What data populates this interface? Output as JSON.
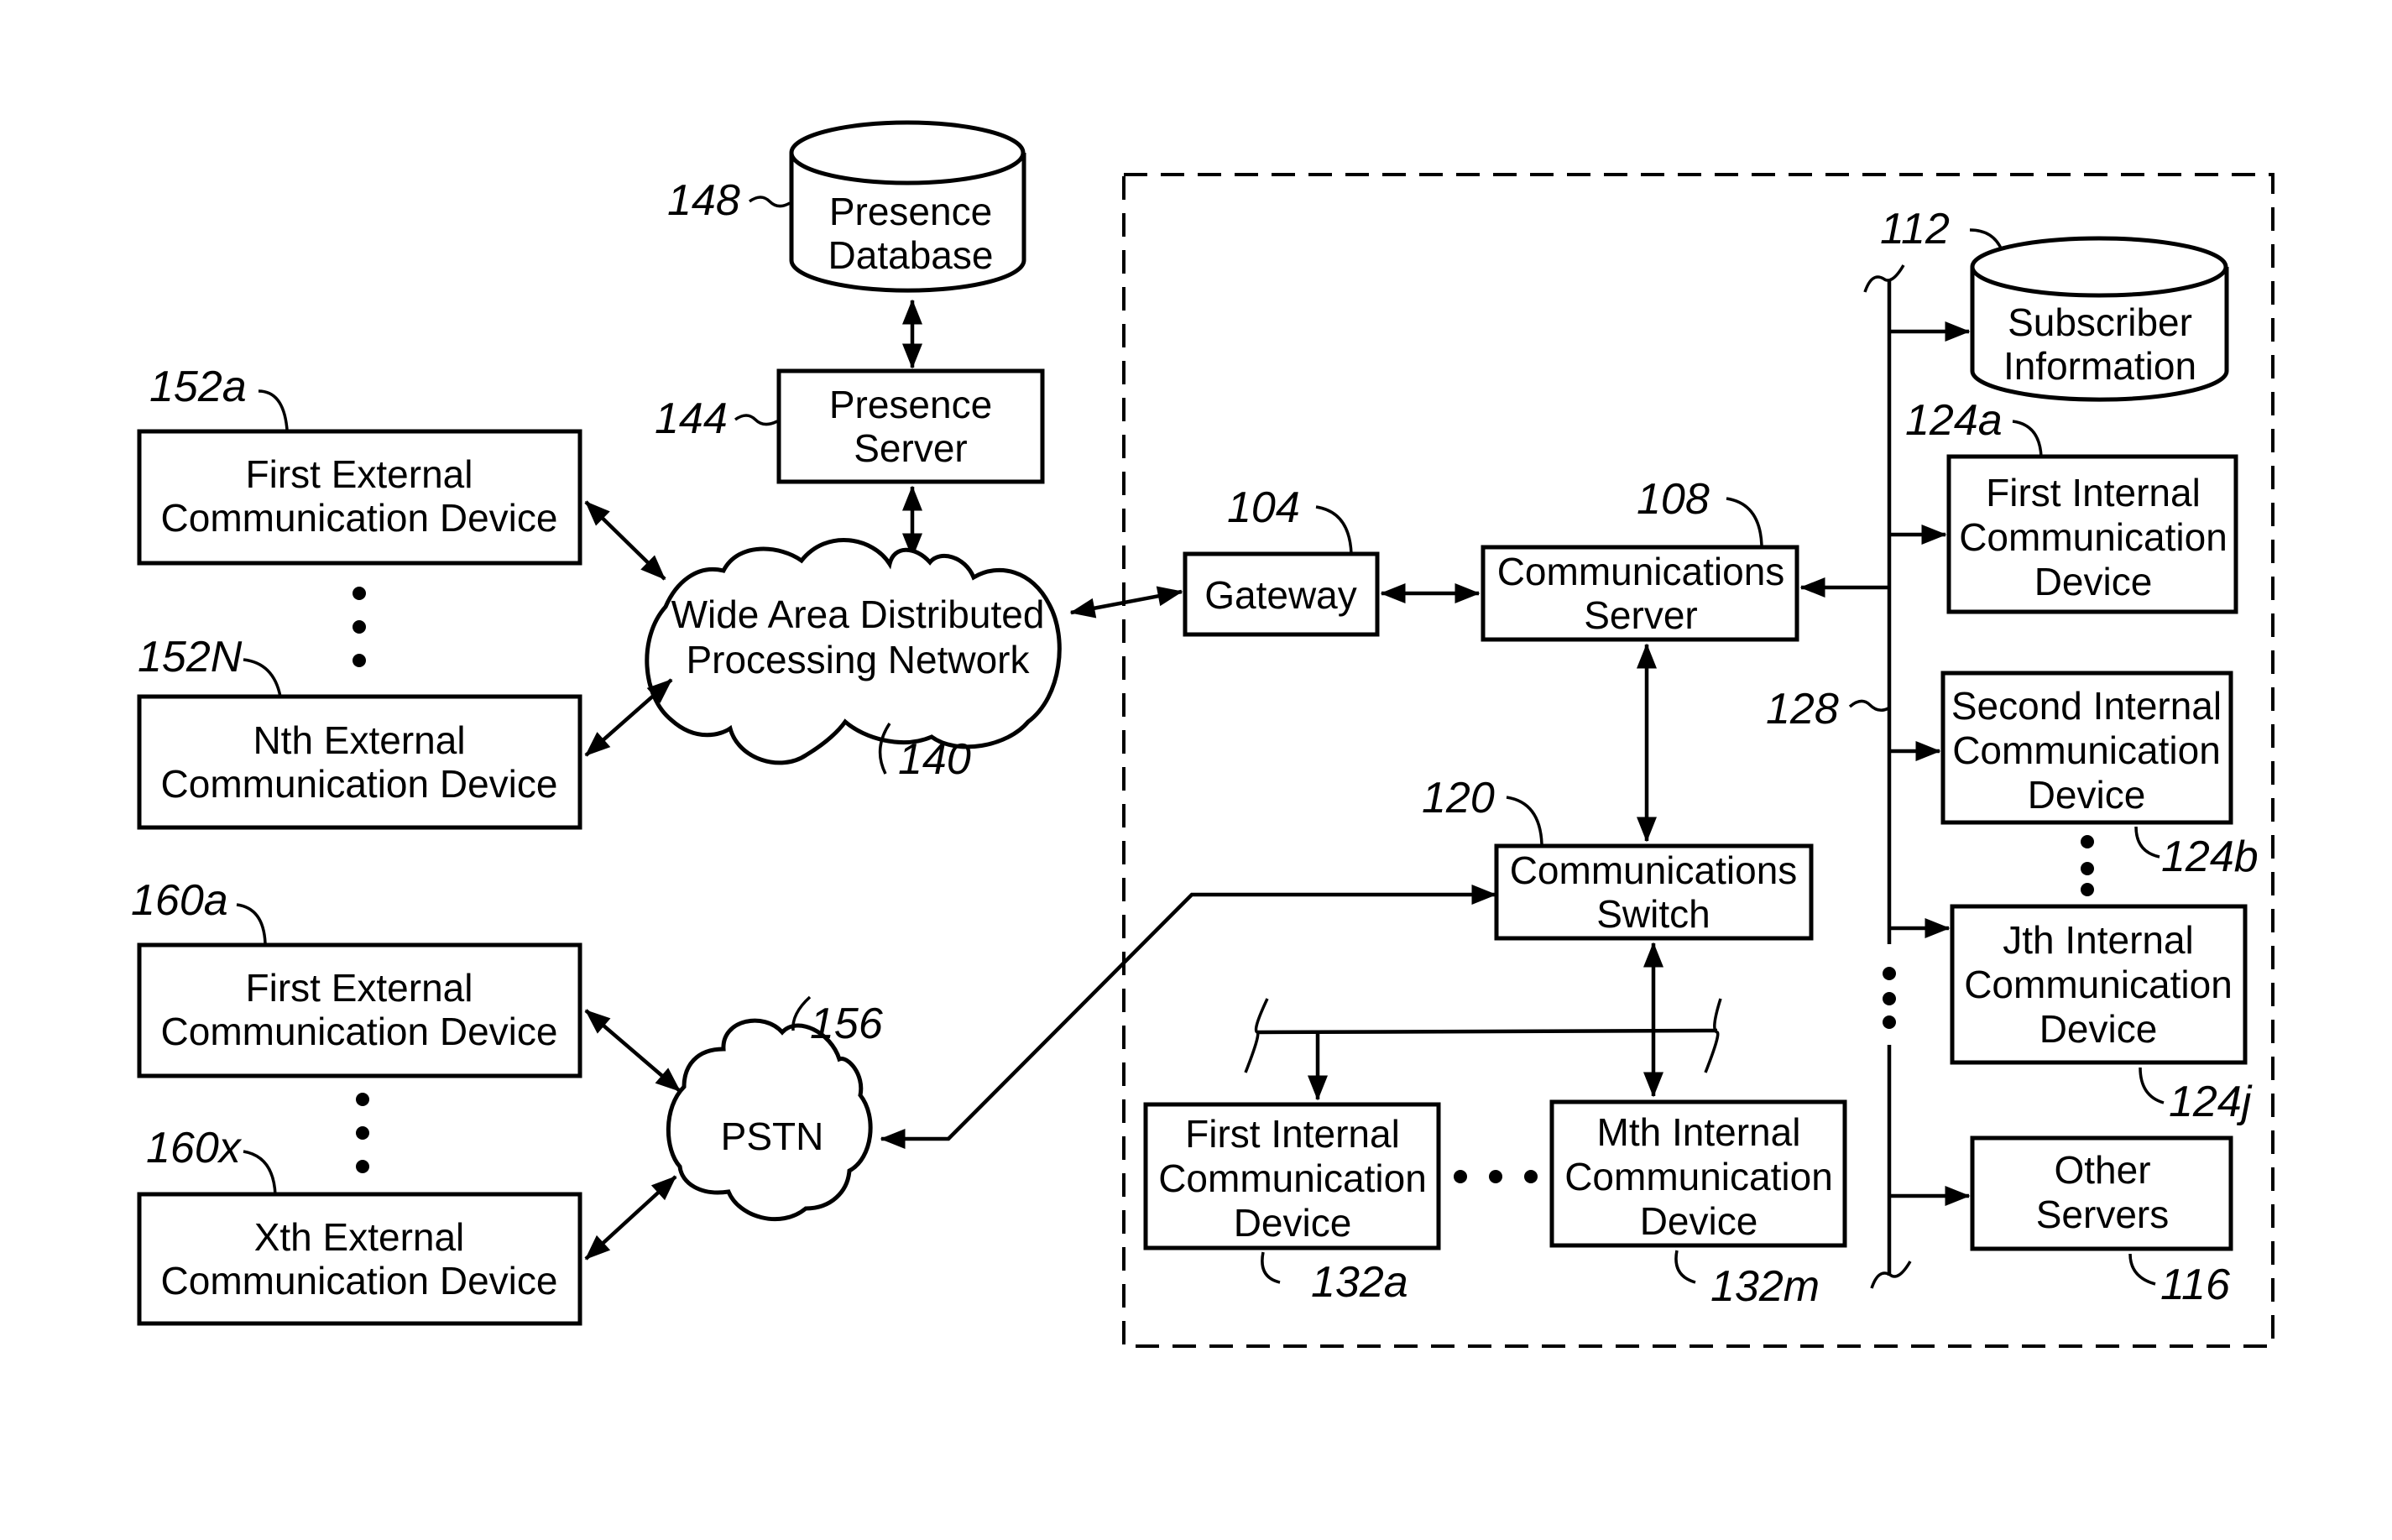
{
  "figure": {
    "nodes": {
      "presence_database": {
        "lines": [
          "Presence",
          "Database"
        ],
        "ref": "148"
      },
      "presence_server": {
        "lines": [
          "Presence",
          "Server"
        ],
        "ref": "144"
      },
      "wan": {
        "lines": [
          "Wide Area Distributed",
          "Processing Network"
        ],
        "ref": "140"
      },
      "ext_152a": {
        "lines": [
          "First External",
          "Communication Device"
        ],
        "ref": "152a"
      },
      "ext_152n": {
        "lines": [
          "Nth External",
          "Communication Device"
        ],
        "ref": "152N"
      },
      "ext_160a": {
        "lines": [
          "First External",
          "Communication Device"
        ],
        "ref": "160a"
      },
      "ext_160x": {
        "lines": [
          "Xth External",
          "Communication Device"
        ],
        "ref": "160x"
      },
      "pstn": {
        "lines": [
          "PSTN"
        ],
        "ref": "156"
      },
      "gateway": {
        "lines": [
          "Gateway"
        ],
        "ref": "104"
      },
      "comm_server": {
        "lines": [
          "Communications",
          "Server"
        ],
        "ref": "108"
      },
      "comm_switch": {
        "lines": [
          "Communications",
          "Switch"
        ],
        "ref": "120"
      },
      "subscriber_info": {
        "lines": [
          "Subscriber",
          "Information"
        ],
        "ref": "112"
      },
      "int_124a": {
        "lines": [
          "First Internal",
          "Communication",
          "Device"
        ],
        "ref": "124a"
      },
      "int_124b": {
        "lines": [
          "Second Internal",
          "Communication",
          "Device"
        ],
        "ref": "124b"
      },
      "int_124j": {
        "lines": [
          "Jth Internal",
          "Communication",
          "Device"
        ],
        "ref": "124j"
      },
      "other_servers": {
        "lines": [
          "Other",
          "Servers"
        ],
        "ref": "116"
      },
      "int_132a": {
        "lines": [
          "First Internal",
          "Communication",
          "Device"
        ],
        "ref": "132a"
      },
      "int_132m": {
        "lines": [
          "Mth Internal",
          "Communication",
          "Device"
        ],
        "ref": "132m"
      },
      "lan_bus": {
        "ref": "128"
      }
    }
  }
}
